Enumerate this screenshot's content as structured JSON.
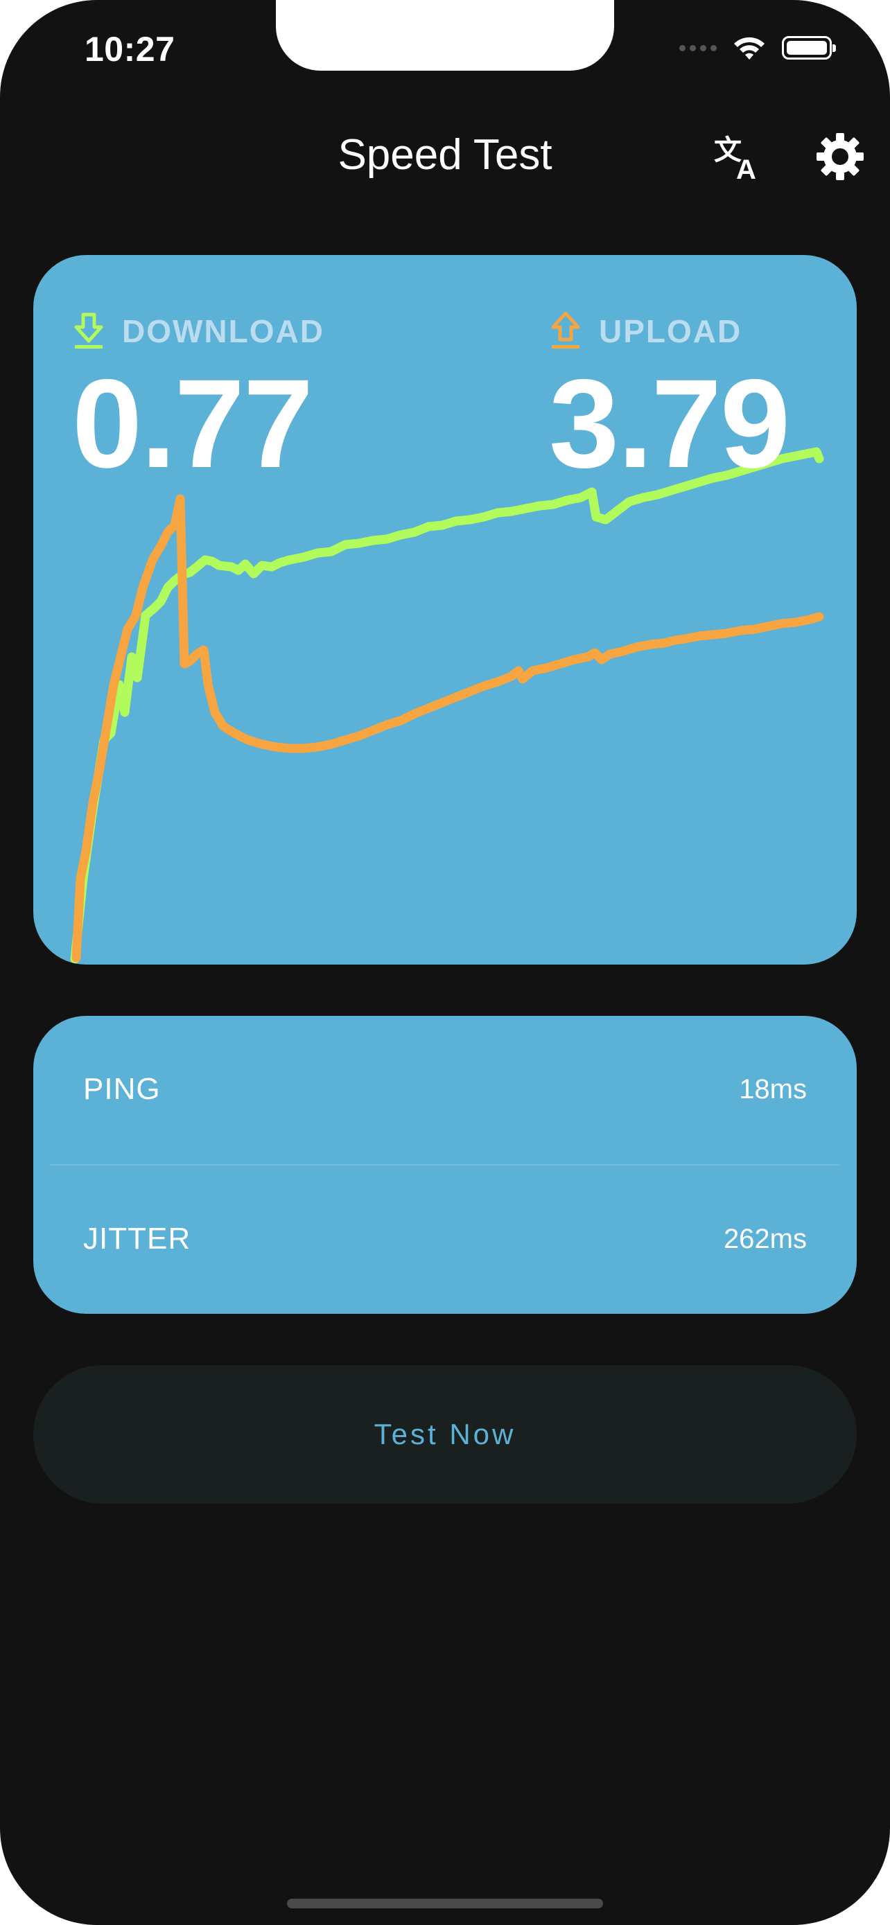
{
  "status_bar": {
    "time": "10:27"
  },
  "header": {
    "title": "Speed Test",
    "translate_icon": "translate-icon",
    "settings_icon": "settings-icon"
  },
  "speed": {
    "download": {
      "label": "DOWNLOAD",
      "value": "0.77",
      "color": "#b2fb5c",
      "icon": "download-icon"
    },
    "upload": {
      "label": "UPLOAD",
      "value": "3.79",
      "color": "#f7a541",
      "icon": "upload-icon"
    }
  },
  "stats": {
    "ping": {
      "label": "PING",
      "value": "18ms"
    },
    "jitter": {
      "label": "JITTER",
      "value": "262ms"
    }
  },
  "actions": {
    "test_now": "Test Now"
  },
  "colors": {
    "background": "#121212",
    "card": "#5cb1d6",
    "download_line": "#b2fb5c",
    "upload_line": "#f7a541",
    "button_bg": "#1a1f20",
    "button_text": "#5cb1d6"
  }
}
